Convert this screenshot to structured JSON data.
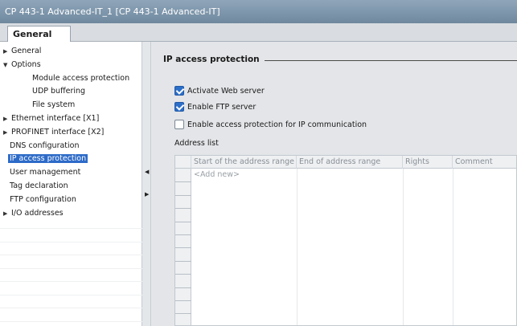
{
  "window": {
    "title": "CP 443-1 Advanced-IT_1 [CP 443-1 Advanced-IT]"
  },
  "tabs": {
    "active": "General"
  },
  "nav": {
    "items": [
      {
        "label": "General",
        "arrow": "right",
        "indent": 0
      },
      {
        "label": "Options",
        "arrow": "down",
        "indent": 0
      },
      {
        "label": "Module access protection",
        "arrow": "",
        "indent": 2
      },
      {
        "label": "UDP buffering",
        "arrow": "",
        "indent": 2
      },
      {
        "label": "File system",
        "arrow": "",
        "indent": 2
      },
      {
        "label": "Ethernet interface [X1]",
        "arrow": "right",
        "indent": 0
      },
      {
        "label": "PROFINET interface [X2]",
        "arrow": "right",
        "indent": 0
      },
      {
        "label": "DNS configuration",
        "arrow": "",
        "indent": 1
      },
      {
        "label": "IP access protection",
        "arrow": "",
        "indent": 1,
        "selected": true
      },
      {
        "label": "User management",
        "arrow": "",
        "indent": 1
      },
      {
        "label": "Tag declaration",
        "arrow": "",
        "indent": 1
      },
      {
        "label": "FTP configuration",
        "arrow": "",
        "indent": 1
      },
      {
        "label": "I/O addresses",
        "arrow": "right",
        "indent": 0
      }
    ]
  },
  "section": {
    "title": "IP access protection",
    "options": [
      {
        "label": "Activate Web server",
        "checked": true
      },
      {
        "label": "Enable FTP server",
        "checked": true
      },
      {
        "label": "Enable access protection for IP communication",
        "checked": false
      }
    ],
    "list_label": "Address list",
    "table": {
      "columns": [
        "Start of the address range",
        "End of address range",
        "Rights",
        "Comment"
      ],
      "placeholder_row": "<Add new>"
    }
  }
}
